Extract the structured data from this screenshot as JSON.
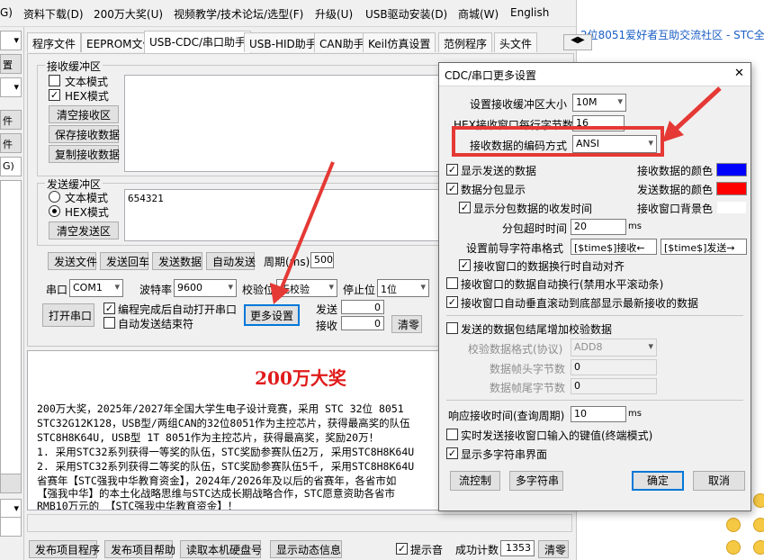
{
  "menu": {
    "items": [
      "G)",
      "资料下载(D)",
      "200万大奖(U)",
      "视频教学/技术论坛/选型(F)",
      "升级(U)",
      "USB驱动安装(D)",
      "商城(W)",
      "English"
    ]
  },
  "browser": {
    "forum_link": "2位8051爱好者互助交流社区 - STC全"
  },
  "left_strip": {
    "items": [
      "置",
      "件",
      "件",
      "G)"
    ]
  },
  "tabs": [
    "程序文件",
    "EEPROM文件",
    "USB-CDC/串口助手",
    "USB-HID助手",
    "CAN助手",
    "Keil仿真设置",
    "范例程序",
    "头文件"
  ],
  "tab_arrows": "◀▶",
  "receive": {
    "group_label": "接收缓冲区",
    "text_mode": "文本模式",
    "hex_mode": "HEX模式",
    "clear": "清空接收区",
    "save": "保存接收数据",
    "copy": "复制接收数据"
  },
  "send": {
    "group_label": "发送缓冲区",
    "text_mode": "文本模式",
    "hex_mode": "HEX模式",
    "clear": "清空发送区",
    "content": "654321"
  },
  "bottom_buttons": {
    "send_file": "发送文件",
    "send_return": "发送回车",
    "send_data": "发送数据",
    "auto_send": "自动发送",
    "period_label": "周期(ms)",
    "period_value": "500"
  },
  "port": {
    "port_label": "串口",
    "port_value": "COM1",
    "baud_label": "波特率",
    "baud_value": "9600",
    "parity_label": "校验位",
    "parity_value": "无校验",
    "stop_label": "停止位",
    "stop_value": "1位",
    "open": "打开串口",
    "auto_open": "编程完成后自动打开串口",
    "auto_send_end": "自动发送结束符",
    "more": "更多设置",
    "send_label": "发送",
    "send_count": "0",
    "recv_label": "接收",
    "recv_count": "0",
    "clear": "清零"
  },
  "output": {
    "banner": "200万大奖",
    "lines": [
      "200万大奖，2025年/2027年全国大学生电子设计竞赛，采用 STC 32位 8051",
      "STC32G12K128，USB型/两组CAN的32位8051作为主控芯片，获得最高奖的队伍",
      "STC8H8K64U, USB型 1T 8051作为主控芯片，获得最高奖，奖励20万！",
      "1. 采用STC32系列获得一等奖的队伍，STC奖励参赛队伍2万, 采用STC8H8K64U",
      "2. 采用STC32系列获得二等奖的队伍，STC奖励参赛队伍5千, 采用STC8H8K64U",
      "省赛年【STC强我中华教育资金】，2024年/2026年及以后的省赛年，各省市如",
      "【强我中华】的本土化战略思维与STC达成长期战略合作，STC愿意资助各省市",
      "RMB10万元的 【STC强我中华教育资金】！"
    ]
  },
  "status_bar": {
    "publish": "发布项目程序",
    "publish_help": "发布项目帮助",
    "read_disk": "读取本机硬盘号",
    "show_dynamic": "显示动态信息",
    "beep": "提示音",
    "success_label": "成功计数",
    "success_value": "1353",
    "clear": "清零"
  },
  "dialog": {
    "title": "CDC/串口更多设置",
    "close": "✕",
    "buf_size_label": "设置接收缓冲区大小",
    "buf_size_value": "10M",
    "hex_bytes_label": "HEX接收窗口每行字节数",
    "hex_bytes_value": "16",
    "encoding_label": "接收数据的编码方式",
    "encoding_value": "ANSI",
    "show_sent": "显示发送的数据",
    "recv_color_label": "接收数据的颜色",
    "recv_color": "#0000ff",
    "packet_display": "数据分包显示",
    "send_color_label": "发送数据的颜色",
    "send_color": "#ff0000",
    "show_packet_time": "显示分包数据的收发时间",
    "bg_color_label": "接收窗口背景色",
    "bg_color": "#ffffff",
    "packet_timeout_label": "分包超时时间",
    "packet_timeout_value": "20",
    "ms": "ms",
    "prefix_label": "设置前导字符串格式",
    "prefix_recv": "[$time$]接收←",
    "prefix_send": "[$time$]发送→",
    "auto_align": "接收窗口的数据换行时自动对齐",
    "auto_wrap": "接收窗口的数据自动换行(禁用水平滚动条)",
    "auto_scroll": "接收窗口自动垂直滚动到底部显示最新接收的数据",
    "append_checksum": "发送的数据包结尾增加校验数据",
    "checksum_format_label": "校验数据格式(协议)",
    "checksum_format_value": "ADD8",
    "frame_head_label": "数据帧头字节数",
    "frame_head_value": "0",
    "frame_tail_label": "数据帧尾字节数",
    "frame_tail_value": "0",
    "response_time_label": "响应接收时间(查询周期)",
    "response_time_value": "10",
    "realtime_send": "实时发送接收窗口输入的键值(终端模式)",
    "show_multi": "显示多字符串界面",
    "flow_control": "流控制",
    "multi_string": "多字符串",
    "ok": "确定",
    "cancel": "取消"
  },
  "colors": {
    "highlight": "#e53935",
    "banner": "#e01b1b",
    "link": "#1a5ec6"
  }
}
